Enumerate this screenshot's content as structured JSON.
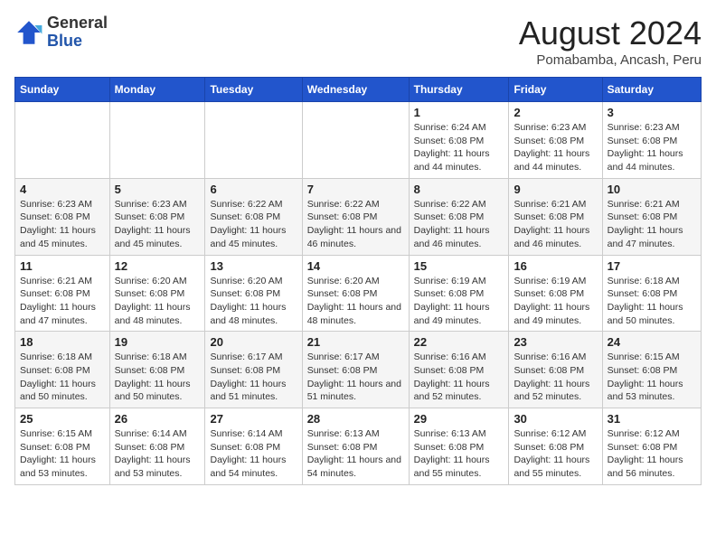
{
  "header": {
    "logo_general": "General",
    "logo_blue": "Blue",
    "month_year": "August 2024",
    "location": "Pomabamba, Ancash, Peru"
  },
  "weekdays": [
    "Sunday",
    "Monday",
    "Tuesday",
    "Wednesday",
    "Thursday",
    "Friday",
    "Saturday"
  ],
  "weeks": [
    [
      {
        "day": "",
        "info": ""
      },
      {
        "day": "",
        "info": ""
      },
      {
        "day": "",
        "info": ""
      },
      {
        "day": "",
        "info": ""
      },
      {
        "day": "1",
        "info": "Sunrise: 6:24 AM\nSunset: 6:08 PM\nDaylight: 11 hours and 44 minutes."
      },
      {
        "day": "2",
        "info": "Sunrise: 6:23 AM\nSunset: 6:08 PM\nDaylight: 11 hours and 44 minutes."
      },
      {
        "day": "3",
        "info": "Sunrise: 6:23 AM\nSunset: 6:08 PM\nDaylight: 11 hours and 44 minutes."
      }
    ],
    [
      {
        "day": "4",
        "info": "Sunrise: 6:23 AM\nSunset: 6:08 PM\nDaylight: 11 hours and 45 minutes."
      },
      {
        "day": "5",
        "info": "Sunrise: 6:23 AM\nSunset: 6:08 PM\nDaylight: 11 hours and 45 minutes."
      },
      {
        "day": "6",
        "info": "Sunrise: 6:22 AM\nSunset: 6:08 PM\nDaylight: 11 hours and 45 minutes."
      },
      {
        "day": "7",
        "info": "Sunrise: 6:22 AM\nSunset: 6:08 PM\nDaylight: 11 hours and 46 minutes."
      },
      {
        "day": "8",
        "info": "Sunrise: 6:22 AM\nSunset: 6:08 PM\nDaylight: 11 hours and 46 minutes."
      },
      {
        "day": "9",
        "info": "Sunrise: 6:21 AM\nSunset: 6:08 PM\nDaylight: 11 hours and 46 minutes."
      },
      {
        "day": "10",
        "info": "Sunrise: 6:21 AM\nSunset: 6:08 PM\nDaylight: 11 hours and 47 minutes."
      }
    ],
    [
      {
        "day": "11",
        "info": "Sunrise: 6:21 AM\nSunset: 6:08 PM\nDaylight: 11 hours and 47 minutes."
      },
      {
        "day": "12",
        "info": "Sunrise: 6:20 AM\nSunset: 6:08 PM\nDaylight: 11 hours and 48 minutes."
      },
      {
        "day": "13",
        "info": "Sunrise: 6:20 AM\nSunset: 6:08 PM\nDaylight: 11 hours and 48 minutes."
      },
      {
        "day": "14",
        "info": "Sunrise: 6:20 AM\nSunset: 6:08 PM\nDaylight: 11 hours and 48 minutes."
      },
      {
        "day": "15",
        "info": "Sunrise: 6:19 AM\nSunset: 6:08 PM\nDaylight: 11 hours and 49 minutes."
      },
      {
        "day": "16",
        "info": "Sunrise: 6:19 AM\nSunset: 6:08 PM\nDaylight: 11 hours and 49 minutes."
      },
      {
        "day": "17",
        "info": "Sunrise: 6:18 AM\nSunset: 6:08 PM\nDaylight: 11 hours and 50 minutes."
      }
    ],
    [
      {
        "day": "18",
        "info": "Sunrise: 6:18 AM\nSunset: 6:08 PM\nDaylight: 11 hours and 50 minutes."
      },
      {
        "day": "19",
        "info": "Sunrise: 6:18 AM\nSunset: 6:08 PM\nDaylight: 11 hours and 50 minutes."
      },
      {
        "day": "20",
        "info": "Sunrise: 6:17 AM\nSunset: 6:08 PM\nDaylight: 11 hours and 51 minutes."
      },
      {
        "day": "21",
        "info": "Sunrise: 6:17 AM\nSunset: 6:08 PM\nDaylight: 11 hours and 51 minutes."
      },
      {
        "day": "22",
        "info": "Sunrise: 6:16 AM\nSunset: 6:08 PM\nDaylight: 11 hours and 52 minutes."
      },
      {
        "day": "23",
        "info": "Sunrise: 6:16 AM\nSunset: 6:08 PM\nDaylight: 11 hours and 52 minutes."
      },
      {
        "day": "24",
        "info": "Sunrise: 6:15 AM\nSunset: 6:08 PM\nDaylight: 11 hours and 53 minutes."
      }
    ],
    [
      {
        "day": "25",
        "info": "Sunrise: 6:15 AM\nSunset: 6:08 PM\nDaylight: 11 hours and 53 minutes."
      },
      {
        "day": "26",
        "info": "Sunrise: 6:14 AM\nSunset: 6:08 PM\nDaylight: 11 hours and 53 minutes."
      },
      {
        "day": "27",
        "info": "Sunrise: 6:14 AM\nSunset: 6:08 PM\nDaylight: 11 hours and 54 minutes."
      },
      {
        "day": "28",
        "info": "Sunrise: 6:13 AM\nSunset: 6:08 PM\nDaylight: 11 hours and 54 minutes."
      },
      {
        "day": "29",
        "info": "Sunrise: 6:13 AM\nSunset: 6:08 PM\nDaylight: 11 hours and 55 minutes."
      },
      {
        "day": "30",
        "info": "Sunrise: 6:12 AM\nSunset: 6:08 PM\nDaylight: 11 hours and 55 minutes."
      },
      {
        "day": "31",
        "info": "Sunrise: 6:12 AM\nSunset: 6:08 PM\nDaylight: 11 hours and 56 minutes."
      }
    ]
  ]
}
